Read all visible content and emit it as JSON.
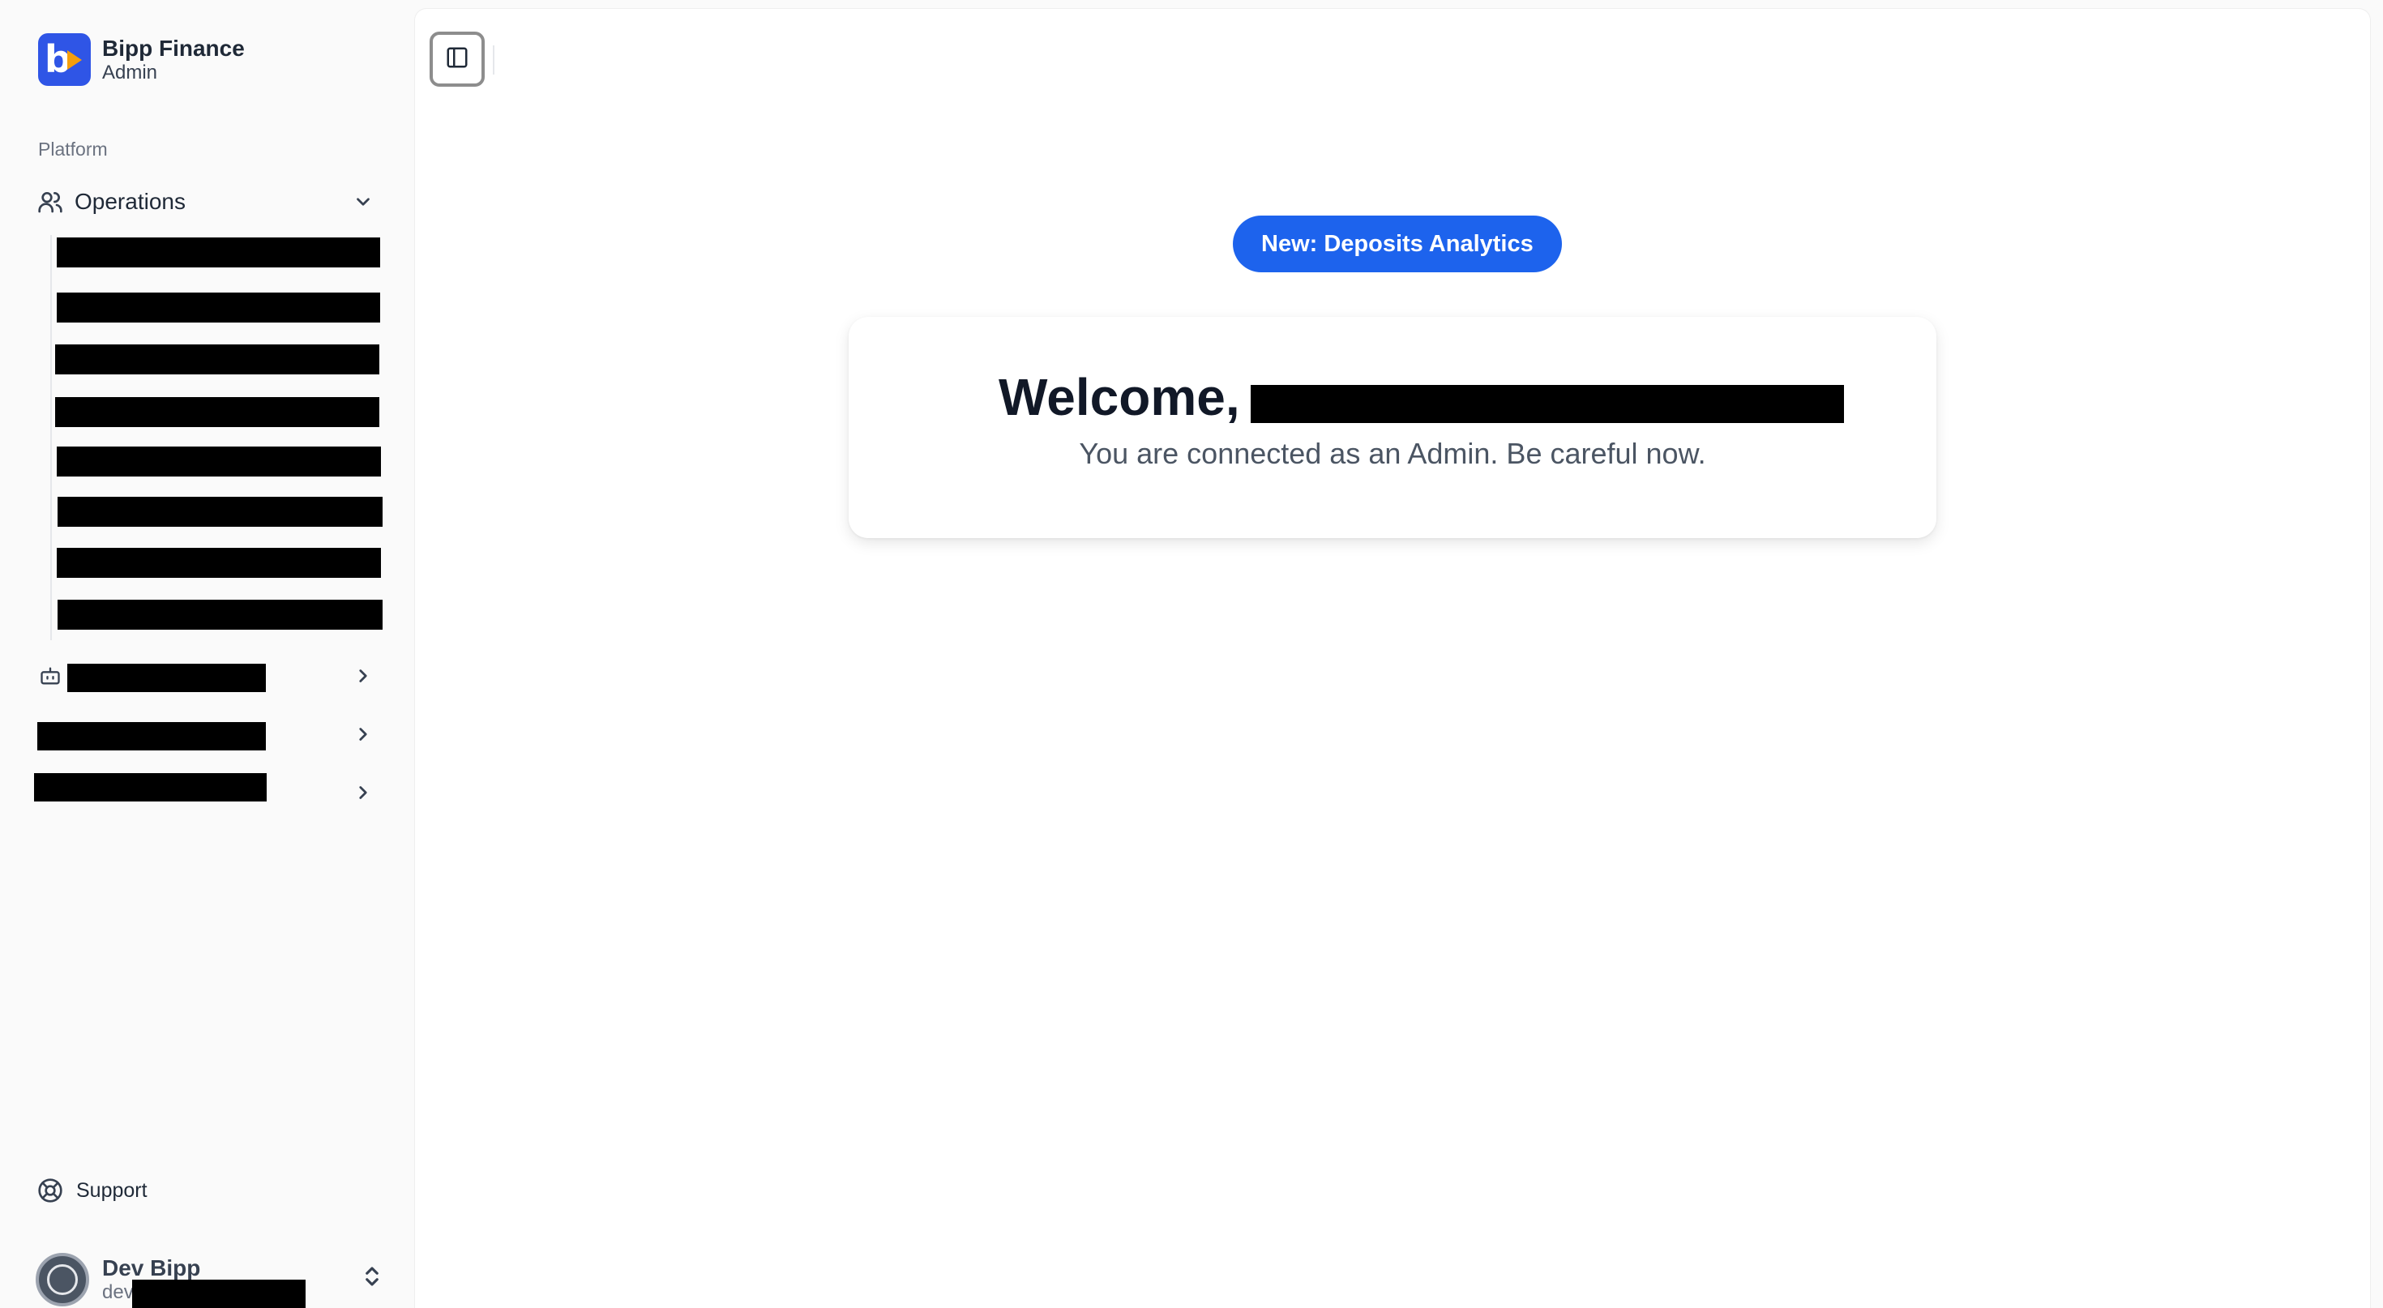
{
  "brand": {
    "name": "Bipp Finance",
    "role": "Admin",
    "logo_letter": "b",
    "color": "#2f55e6"
  },
  "sidebar": {
    "section_label": "Platform",
    "groups": [
      {
        "label": "Operations",
        "icon": "users-icon",
        "expanded": true
      }
    ],
    "support_label": "Support"
  },
  "user": {
    "name": "Dev Bipp",
    "email_prefix": "dev"
  },
  "main": {
    "pill_label": "New: Deposits Analytics",
    "welcome_prefix": "Welcome,",
    "welcome_subtitle": "You are connected as an Admin. Be careful now.",
    "accent_color": "#1d63ed"
  }
}
